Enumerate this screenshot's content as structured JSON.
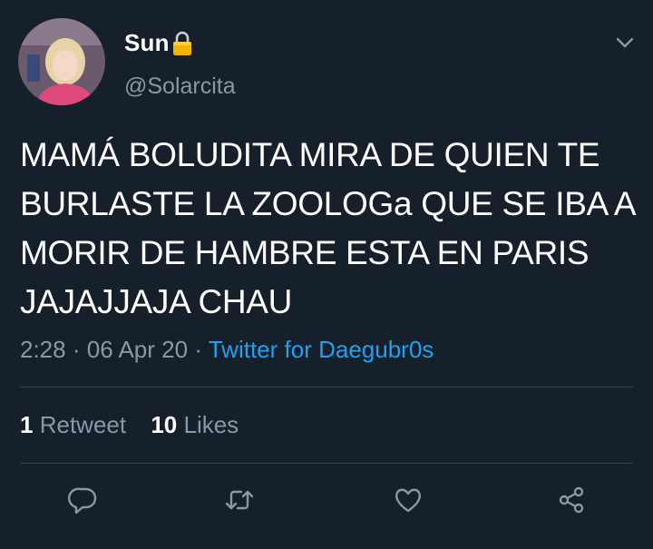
{
  "user": {
    "display_name": "Sun",
    "handle": "@Solarcita",
    "lock_icon": "lock-icon",
    "avatar": "avatar"
  },
  "tweet": {
    "text": "MAMÁ BOLUDITA MIRA DE QUIEN TE BURLASTE LA ZOOLOGa QUE SE IBA A MORIR DE HAMBRE ESTA EN PARIS JAJAJJAJA CHAU",
    "time": "2:28",
    "separator": "·",
    "date": "06 Apr 20",
    "source": "Twitter for Daegubr0s"
  },
  "stats": {
    "retweets_count": "1",
    "retweets_label": "Retweet",
    "likes_count": "10",
    "likes_label": "Likes"
  },
  "actions": [
    "reply-icon",
    "retweet-icon",
    "like-icon",
    "share-icon"
  ],
  "colors": {
    "background": "#15202b",
    "text": "#ffffff",
    "secondary": "#8899a6",
    "accent": "#1da1f2",
    "divider": "#38444d"
  }
}
